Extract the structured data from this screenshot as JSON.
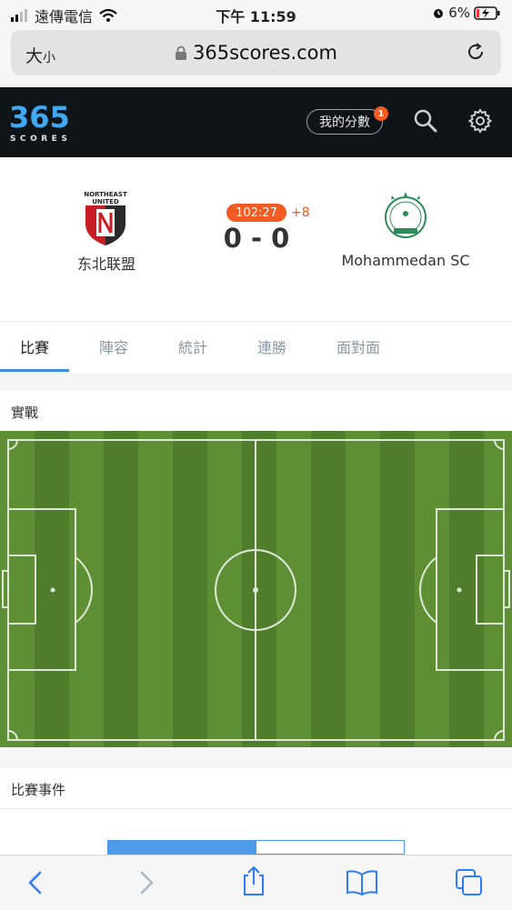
{
  "status_bar": {
    "carrier": "遠傳電信",
    "time": "下午 11:59",
    "battery": "6%"
  },
  "browser": {
    "text_size": "大",
    "text_size_small": "小",
    "url": "365scores.com"
  },
  "app": {
    "logo_top": "365",
    "logo_bottom": "SCORES",
    "my_scores_label": "我的分數",
    "my_scores_badge": "1"
  },
  "match": {
    "home_team": "东北联盟",
    "home_crest_text_1": "NORTHEAST",
    "home_crest_text_2": "UNITED",
    "away_team": "Mohammedan SC",
    "clock": "102:27",
    "added_time": "+8",
    "score": "0 - 0"
  },
  "tabs": [
    {
      "label": "比賽"
    },
    {
      "label": "陣容"
    },
    {
      "label": "統計"
    },
    {
      "label": "連勝"
    },
    {
      "label": "面對面"
    }
  ],
  "sections": {
    "lineup_title": "實戰",
    "events_title": "比賽事件"
  },
  "colors": {
    "accent": "#f25b22",
    "tab_underline": "#3a8fe0",
    "header_bg": "#0f1418",
    "pitch_light": "#5e8f34",
    "pitch_dark": "#4f7d2b",
    "events_bar": "#4c9be8"
  }
}
